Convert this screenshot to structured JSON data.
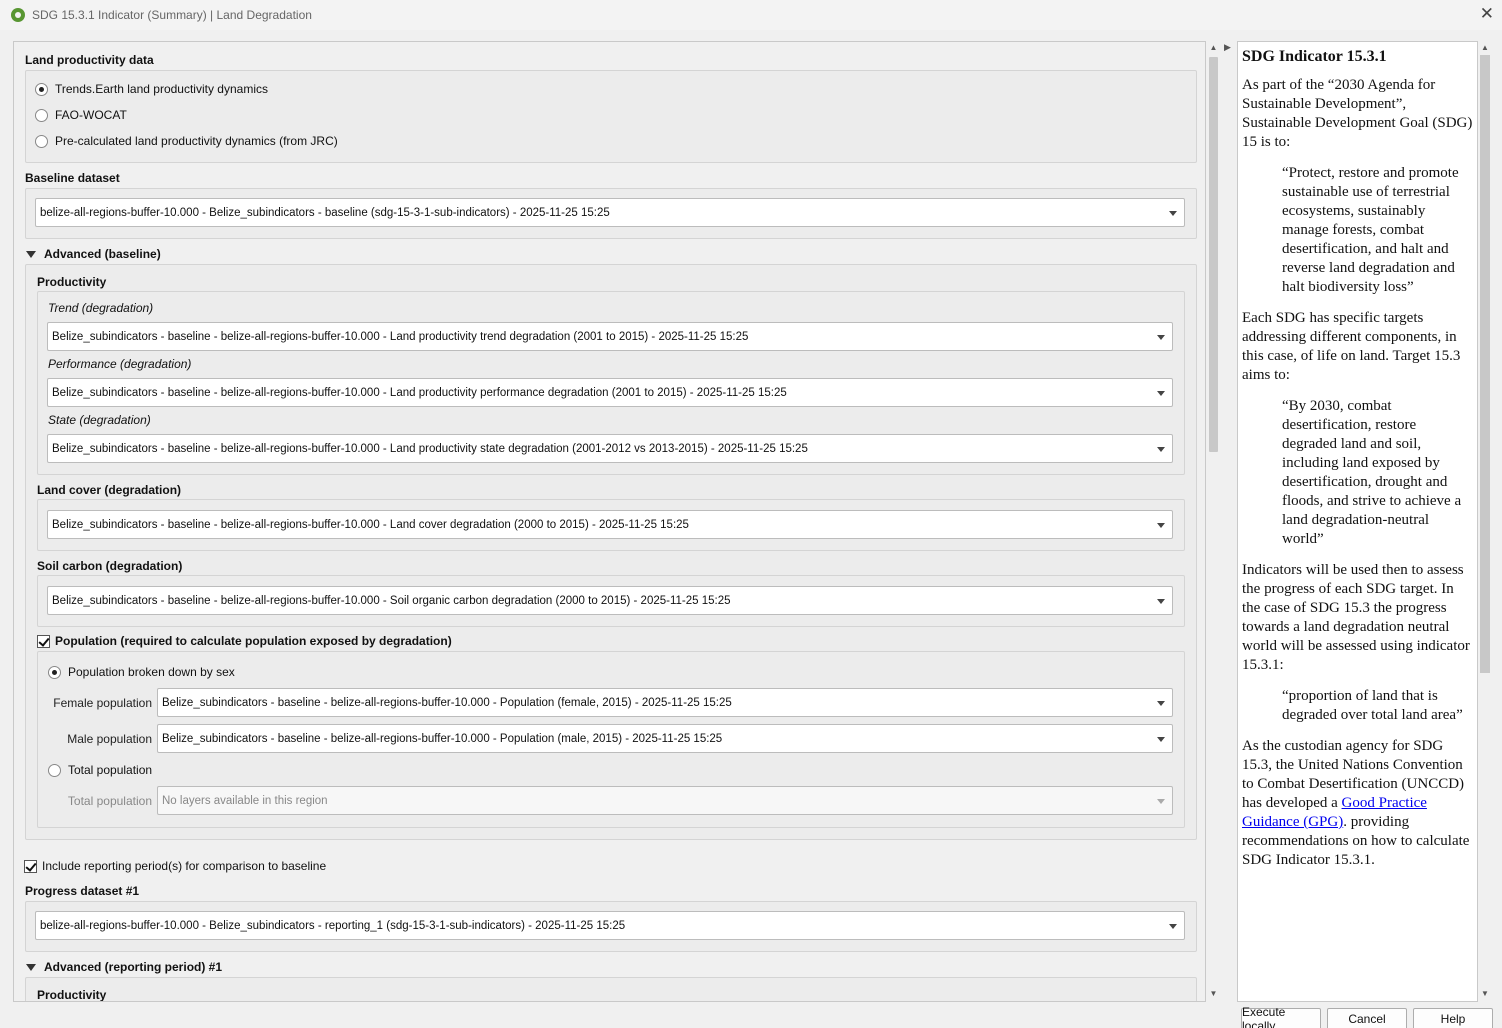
{
  "window": {
    "title": "SDG 15.3.1 Indicator (Summary) | Land Degradation",
    "close_glyph": "✕"
  },
  "land_productivity": {
    "heading": "Land productivity data",
    "options": [
      "Trends.Earth land productivity dynamics",
      "FAO-WOCAT",
      "Pre-calculated land productivity dynamics (from JRC)"
    ],
    "selected_index": 0
  },
  "baseline": {
    "heading": "Baseline dataset",
    "value": "belize-all-regions-buffer-10.000 - Belize_subindicators - baseline (sdg-15-3-1-sub-indicators) - 2025-11-25 15:25"
  },
  "advanced_baseline": {
    "heading": "Advanced (baseline)",
    "productivity_heading": "Productivity",
    "trend_label": "Trend (degradation)",
    "trend_value": "Belize_subindicators - baseline - belize-all-regions-buffer-10.000 - Land productivity trend degradation (2001 to 2015) - 2025-11-25 15:25",
    "performance_label": "Performance (degradation)",
    "performance_value": "Belize_subindicators - baseline - belize-all-regions-buffer-10.000 - Land productivity performance degradation (2001 to 2015) - 2025-11-25 15:25",
    "state_label": "State (degradation)",
    "state_value": "Belize_subindicators - baseline - belize-all-regions-buffer-10.000 - Land productivity state degradation (2001-2012 vs 2013-2015) - 2025-11-25 15:25",
    "land_cover_heading": "Land cover (degradation)",
    "land_cover_value": "Belize_subindicators - baseline - belize-all-regions-buffer-10.000 - Land cover degradation (2000 to 2015) - 2025-11-25 15:25",
    "soil_heading": "Soil carbon (degradation)",
    "soil_value": "Belize_subindicators - baseline - belize-all-regions-buffer-10.000 - Soil organic carbon degradation (2000 to 2015) - 2025-11-25 15:25",
    "population_check": "Population (required to calculate population exposed by degradation)",
    "population_checked": true,
    "pop_by_sex": "Population broken down by sex",
    "female_label": "Female population",
    "female_value": "Belize_subindicators - baseline - belize-all-regions-buffer-10.000 - Population (female, 2015) - 2025-11-25 15:25",
    "male_label": "Male population",
    "male_value": "Belize_subindicators - baseline - belize-all-regions-buffer-10.000 - Population (male, 2015) - 2025-11-25 15:25",
    "total_radio": "Total population",
    "total_label": "Total population",
    "total_value": "No layers available in this region"
  },
  "reporting": {
    "include_check": "Include reporting period(s) for comparison to baseline",
    "include_checked": true,
    "progress_heading": "Progress dataset #1",
    "progress_value": "belize-all-regions-buffer-10.000 - Belize_subindicators - reporting_1 (sdg-15-3-1-sub-indicators) - 2025-11-25 15:25",
    "advanced_heading": "Advanced (reporting period) #1",
    "productivity_heading": "Productivity"
  },
  "help": {
    "title": "SDG Indicator 15.3.1",
    "p1": "As part of the “2030 Agenda for Sustainable Development”, Sustainable Development Goal (SDG) 15 is to:",
    "q1": "“Protect, restore and promote sustainable use of terrestrial ecosystems, sustainably manage forests, combat desertification, and halt and reverse land degradation and halt biodiversity loss”",
    "p2": "Each SDG has specific targets addressing different components, in this case, of life on land. Target 15.3 aims to:",
    "q2": "“By 2030, combat desertification, restore degraded land and soil, including land exposed by desertification, drought and floods, and strive to achieve a land degradation-neutral world”",
    "p3": "Indicators will be used then to assess the progress of each SDG target. In the case of SDG 15.3 the progress towards a land degradation neutral world will be assessed using indicator 15.3.1:",
    "q3": "“proportion of land that is degraded over total land area”",
    "p4_start": "As the custodian agency for SDG 15.3, the United Nations Convention to Combat Desertification (UNCCD) has developed a ",
    "p4_link": "Good Practice Guidance (GPG)",
    "p4_end": ". providing recommendations on how to calculate SDG Indicator 15.3.1."
  },
  "buttons": {
    "execute": "Execute locally",
    "cancel": "Cancel",
    "help": "Help"
  }
}
